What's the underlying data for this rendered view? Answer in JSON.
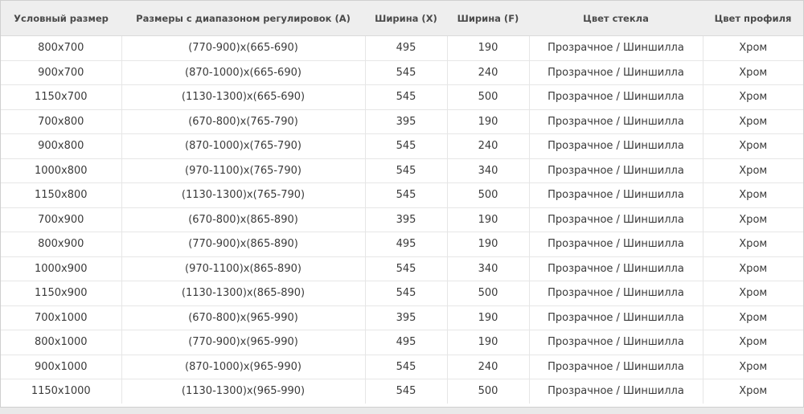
{
  "table": {
    "headers": [
      "Условный размер",
      "Размеры с диапазоном регулировок (А)",
      "Ширина (X)",
      "Ширина (F)",
      "Цвет стекла",
      "Цвет профиля"
    ],
    "rows": [
      [
        "800x700",
        "(770-900)x(665-690)",
        "495",
        "190",
        "Прозрачное / Шиншилла",
        "Хром"
      ],
      [
        "900x700",
        "(870-1000)x(665-690)",
        "545",
        "240",
        "Прозрачное / Шиншилла",
        "Хром"
      ],
      [
        "1150x700",
        "(1130-1300)x(665-690)",
        "545",
        "500",
        "Прозрачное / Шиншилла",
        "Хром"
      ],
      [
        "700x800",
        "(670-800)x(765-790)",
        "395",
        "190",
        "Прозрачное / Шиншилла",
        "Хром"
      ],
      [
        "900x800",
        "(870-1000)x(765-790)",
        "545",
        "240",
        "Прозрачное / Шиншилла",
        "Хром"
      ],
      [
        "1000x800",
        "(970-1100)x(765-790)",
        "545",
        "340",
        "Прозрачное / Шиншилла",
        "Хром"
      ],
      [
        "1150x800",
        "(1130-1300)x(765-790)",
        "545",
        "500",
        "Прозрачное / Шиншилла",
        "Хром"
      ],
      [
        "700x900",
        "(670-800)x(865-890)",
        "395",
        "190",
        "Прозрачное / Шиншилла",
        "Хром"
      ],
      [
        "800x900",
        "(770-900)x(865-890)",
        "495",
        "190",
        "Прозрачное / Шиншилла",
        "Хром"
      ],
      [
        "1000x900",
        "(970-1100)x(865-890)",
        "545",
        "340",
        "Прозрачное / Шиншилла",
        "Хром"
      ],
      [
        "1150x900",
        "(1130-1300)x(865-890)",
        "545",
        "500",
        "Прозрачное / Шиншилла",
        "Хром"
      ],
      [
        "700x1000",
        "(670-800)x(965-990)",
        "395",
        "190",
        "Прозрачное / Шиншилла",
        "Хром"
      ],
      [
        "800x1000",
        "(770-900)x(965-990)",
        "495",
        "190",
        "Прозрачное / Шиншилла",
        "Хром"
      ],
      [
        "900x1000",
        "(870-1000)x(965-990)",
        "545",
        "240",
        "Прозрачное / Шиншилла",
        "Хром"
      ],
      [
        "1150x1000",
        "(1130-1300)x(965-990)",
        "545",
        "500",
        "Прозрачное / Шиншилла",
        "Хром"
      ]
    ]
  }
}
